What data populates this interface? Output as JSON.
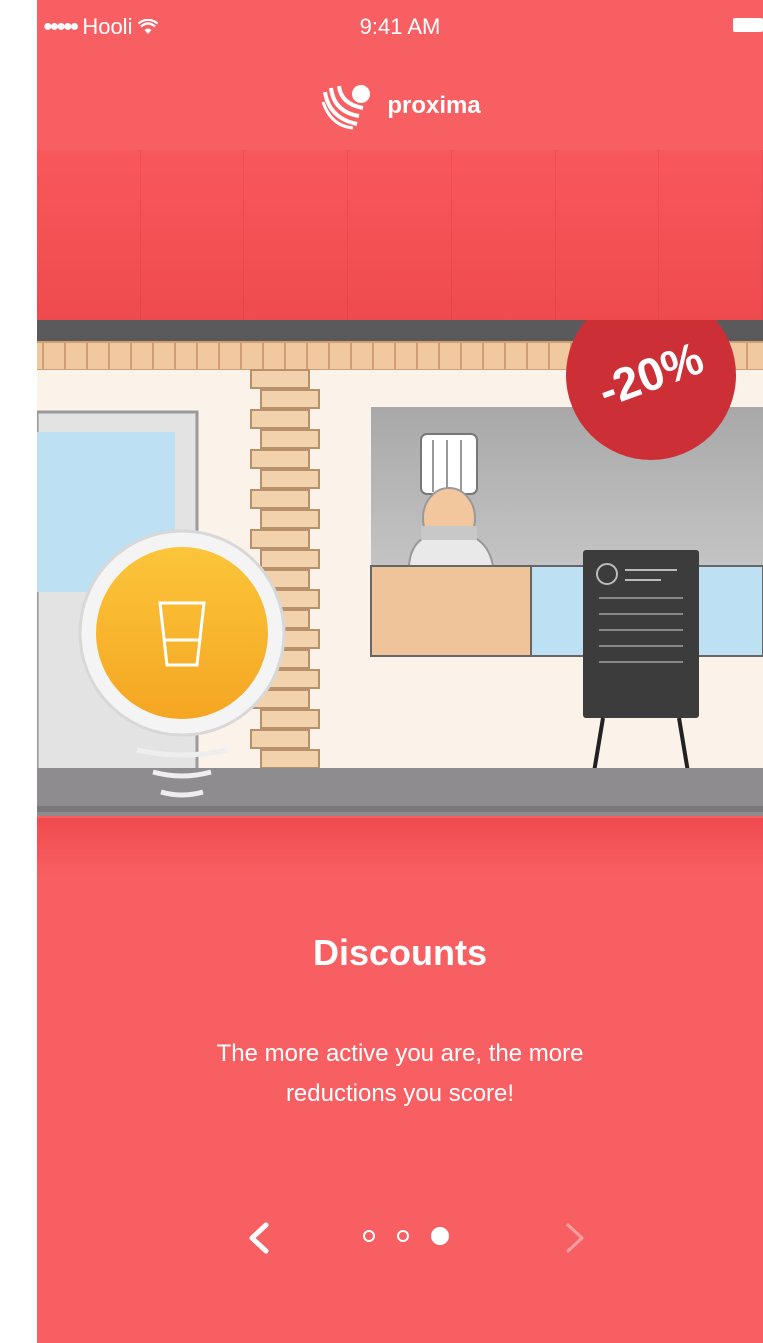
{
  "status_bar": {
    "carrier": "Hooli",
    "time": "9:41 AM"
  },
  "brand": {
    "name": "proxima"
  },
  "illustration": {
    "discount_badge": "-20%",
    "cup_icon": "cup-icon",
    "chef": "chef-icon"
  },
  "onboarding": {
    "title": "Discounts",
    "description_line1": "The more active you are, the more",
    "description_line2": "reductions you score!"
  },
  "pager": {
    "pages": 3,
    "current_page": 3
  },
  "colors": {
    "background": "#f85f62",
    "badge": "#d8323a",
    "cup": "#f7b62a"
  }
}
